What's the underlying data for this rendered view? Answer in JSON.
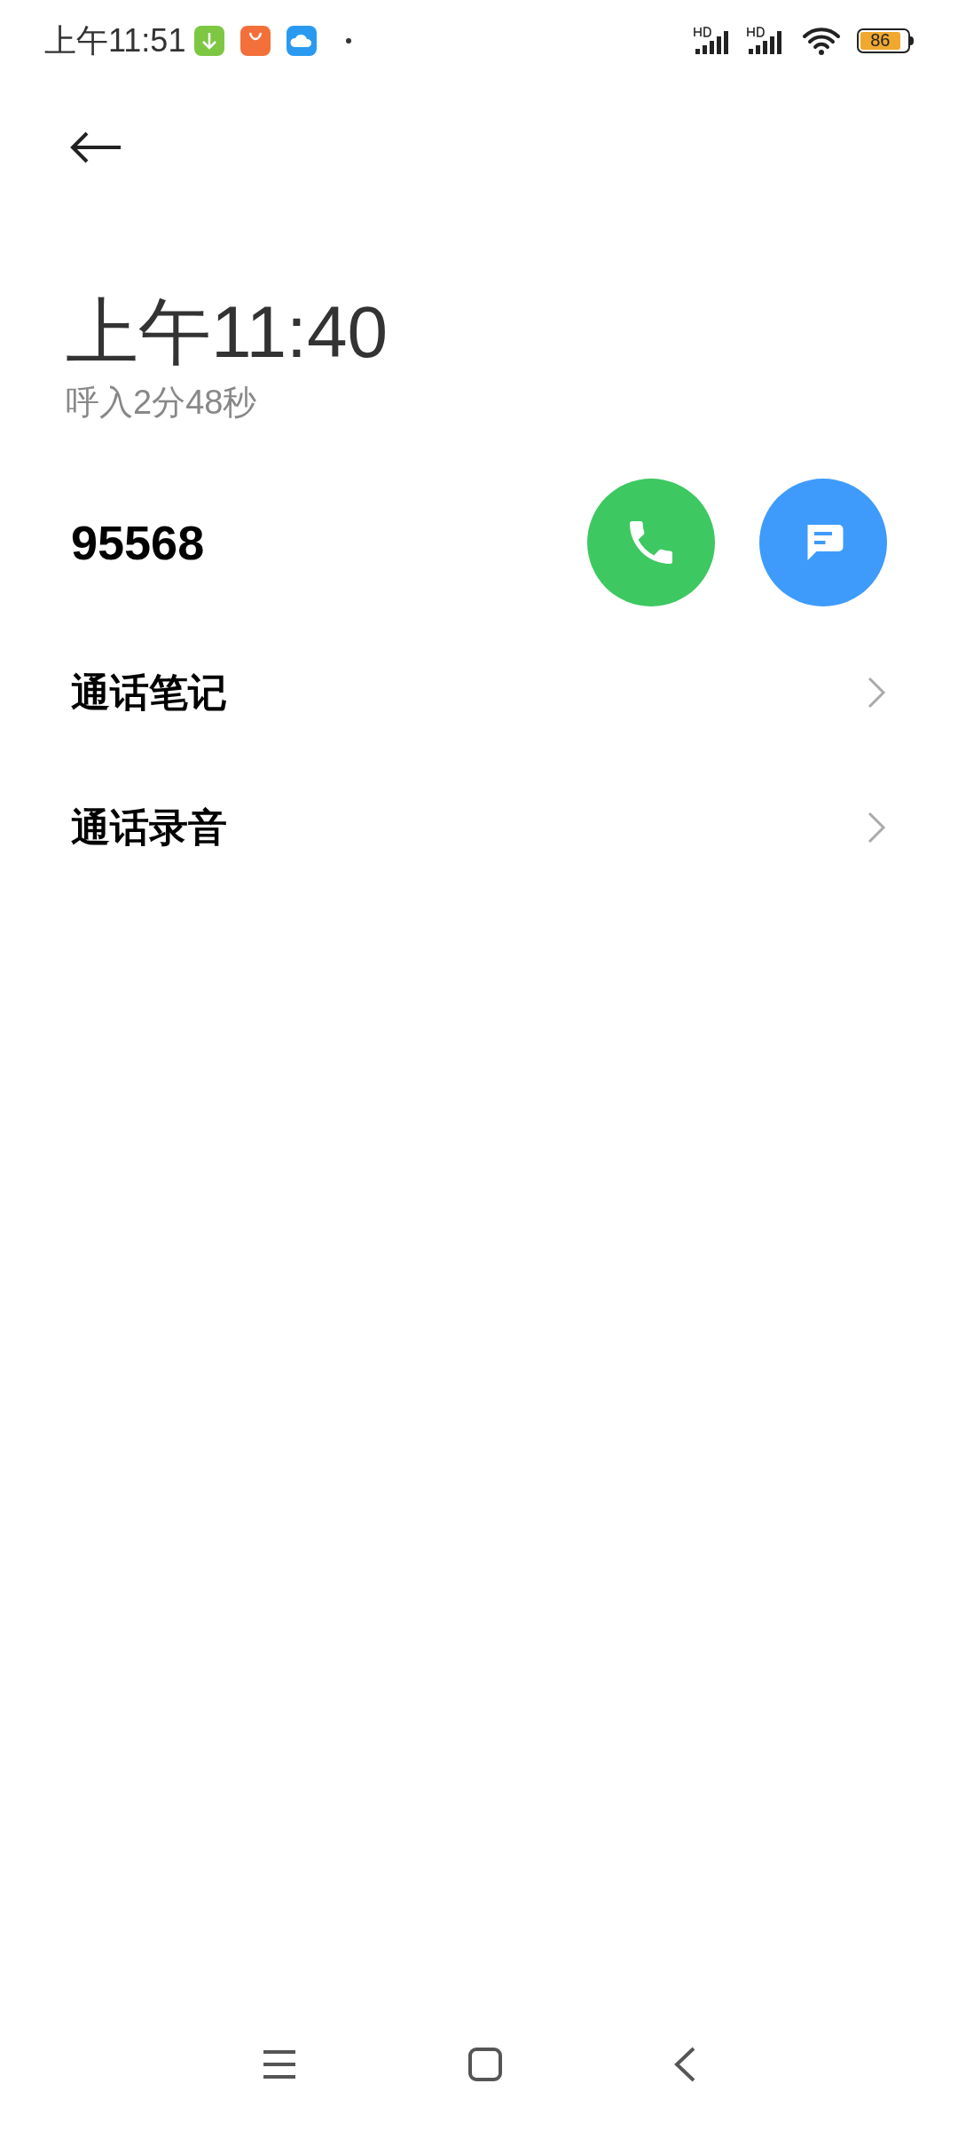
{
  "status_bar": {
    "time": "上午11:51",
    "battery": "86"
  },
  "call": {
    "time": "上午11:40",
    "detail": "呼入2分48秒",
    "number": "95568"
  },
  "rows": [
    {
      "label": "通话笔记"
    },
    {
      "label": "通话录音"
    }
  ]
}
